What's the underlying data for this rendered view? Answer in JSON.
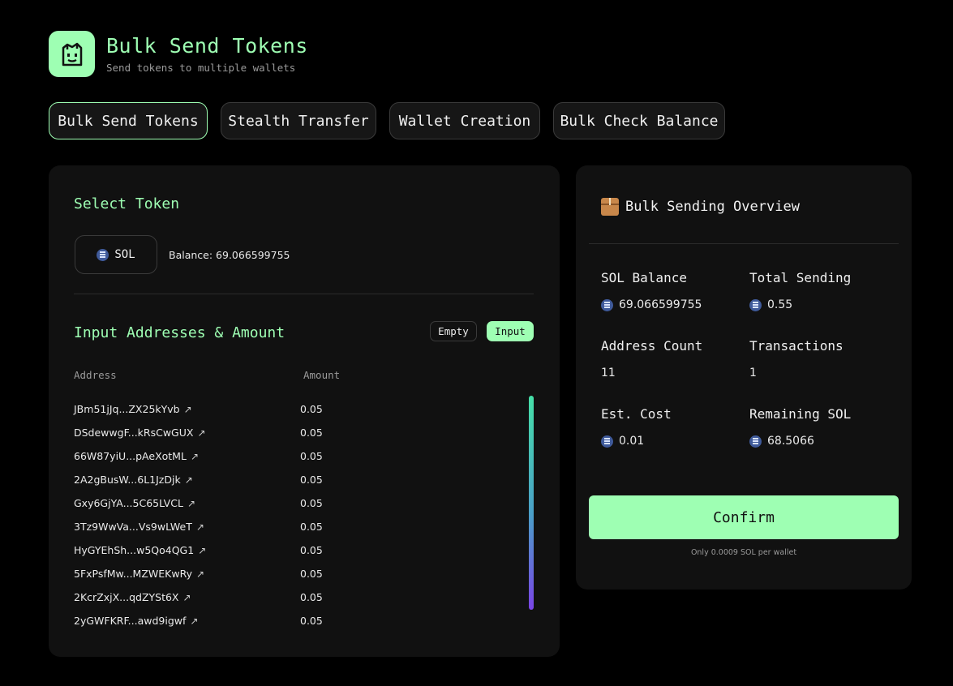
{
  "header": {
    "title": "Bulk Send Tokens",
    "subtitle": "Send tokens to multiple wallets",
    "logo_icon": "shopping-bag-face-icon"
  },
  "tabs": [
    {
      "label": "Bulk Send Tokens",
      "active": true
    },
    {
      "label": "Stealth Transfer",
      "active": false
    },
    {
      "label": "Wallet Creation",
      "active": false
    },
    {
      "label": "Bulk Check Balance",
      "active": false
    }
  ],
  "select_token": {
    "title": "Select Token",
    "token": "SOL",
    "balance": "Balance: 69.066599755"
  },
  "addresses": {
    "title": "Input Addresses & Amount",
    "empty_label": "Empty",
    "input_label": "Input",
    "col_address": "Address",
    "col_amount": "Amount",
    "rows": [
      {
        "address": "JBm51jJq...ZX25kYvb",
        "amount": "0.05"
      },
      {
        "address": "DSdewwgF...kRsCwGUX",
        "amount": "0.05"
      },
      {
        "address": "66W87yiU...pAeXotML",
        "amount": "0.05"
      },
      {
        "address": "2A2gBusW...6L1JzDjk",
        "amount": "0.05"
      },
      {
        "address": "Gxy6GjYA...5C65LVCL",
        "amount": "0.05"
      },
      {
        "address": "3Tz9WwVa...Vs9wLWeT",
        "amount": "0.05"
      },
      {
        "address": "HyGYEhSh...w5Qo4QG1",
        "amount": "0.05"
      },
      {
        "address": "5FxPsfMw...MZWEKwRy",
        "amount": "0.05"
      },
      {
        "address": "2KcrZxjX...qdZYSt6X",
        "amount": "0.05"
      },
      {
        "address": "2yGWFKRF...awd9igwf",
        "amount": "0.05"
      }
    ]
  },
  "overview": {
    "title": "Bulk Sending Overview",
    "sol_balance_label": "SOL Balance",
    "sol_balance": "69.066599755",
    "total_sending_label": "Total Sending",
    "total_sending": "0.55",
    "address_count_label": "Address Count",
    "address_count": "11",
    "transactions_label": "Transactions",
    "transactions": "1",
    "est_cost_label": "Est. Cost",
    "est_cost": "0.01",
    "remaining_label": "Remaining SOL",
    "remaining": "68.5066",
    "confirm_label": "Confirm",
    "note": "Only 0.0009 SOL per wallet"
  },
  "colors": {
    "accent": "#9effb3",
    "background": "#000000",
    "card": "#111111"
  }
}
